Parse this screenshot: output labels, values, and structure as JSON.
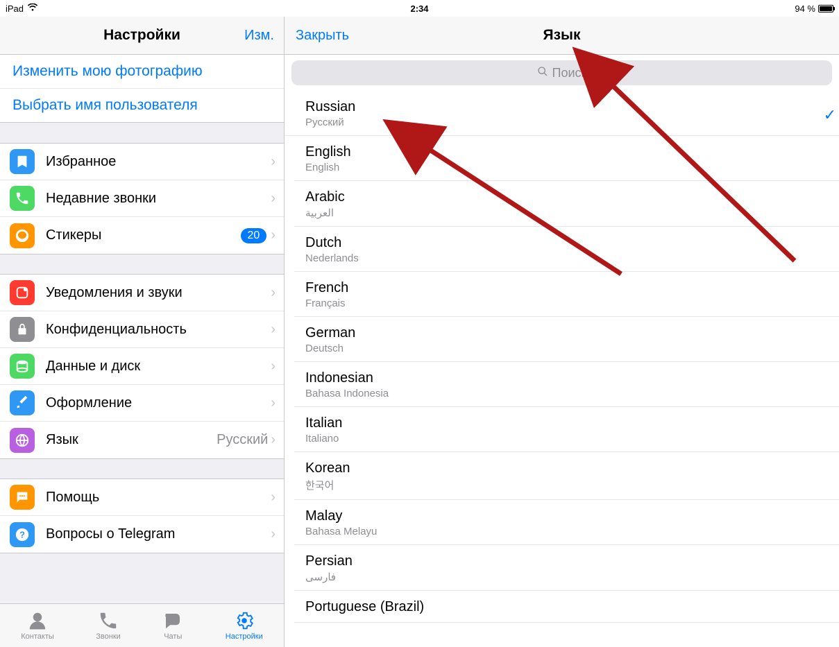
{
  "status": {
    "device": "iPad",
    "time": "2:34",
    "battery_text": "94 %"
  },
  "left": {
    "title": "Настройки",
    "edit": "Изм.",
    "profile_links": [
      "Изменить мою фотографию",
      "Выбрать имя пользователя"
    ],
    "groups": {
      "g1": [
        {
          "icon": "bookmark-icon",
          "color": "#2f98f5",
          "label": "Избранное"
        },
        {
          "icon": "phone-icon",
          "color": "#4cd964",
          "label": "Недавние звонки"
        },
        {
          "icon": "sticker-icon",
          "color": "#ff9500",
          "label": "Стикеры",
          "badge": "20"
        }
      ],
      "g2": [
        {
          "icon": "bell-icon",
          "color": "#ff3b30",
          "label": "Уведомления и звуки"
        },
        {
          "icon": "lock-icon",
          "color": "#8e8e93",
          "label": "Конфиденциальность"
        },
        {
          "icon": "disk-icon",
          "color": "#4cd964",
          "label": "Данные и диск"
        },
        {
          "icon": "brush-icon",
          "color": "#2f98f5",
          "label": "Оформление"
        },
        {
          "icon": "globe-icon",
          "color": "#b860e0",
          "label": "Язык",
          "value": "Русский"
        }
      ],
      "g3": [
        {
          "icon": "chat-icon",
          "color": "#ff9500",
          "label": "Помощь"
        },
        {
          "icon": "question-icon",
          "color": "#2f98f5",
          "label": "Вопросы о Telegram"
        }
      ]
    }
  },
  "tabs": [
    {
      "name": "contacts",
      "label": "Контакты"
    },
    {
      "name": "calls",
      "label": "Звонки"
    },
    {
      "name": "chats",
      "label": "Чаты"
    },
    {
      "name": "settings",
      "label": "Настройки",
      "active": true
    }
  ],
  "right": {
    "close": "Закрыть",
    "title": "Язык",
    "search_placeholder": "Поиск",
    "languages": [
      {
        "name": "Russian",
        "native": "Русский",
        "selected": true
      },
      {
        "name": "English",
        "native": "English"
      },
      {
        "name": "Arabic",
        "native": "العربية"
      },
      {
        "name": "Dutch",
        "native": "Nederlands"
      },
      {
        "name": "French",
        "native": "Français"
      },
      {
        "name": "German",
        "native": "Deutsch"
      },
      {
        "name": "Indonesian",
        "native": "Bahasa Indonesia"
      },
      {
        "name": "Italian",
        "native": "Italiano"
      },
      {
        "name": "Korean",
        "native": "한국어"
      },
      {
        "name": "Malay",
        "native": "Bahasa Melayu"
      },
      {
        "name": "Persian",
        "native": "فارسی"
      },
      {
        "name": "Portuguese (Brazil)",
        "native": ""
      }
    ]
  }
}
